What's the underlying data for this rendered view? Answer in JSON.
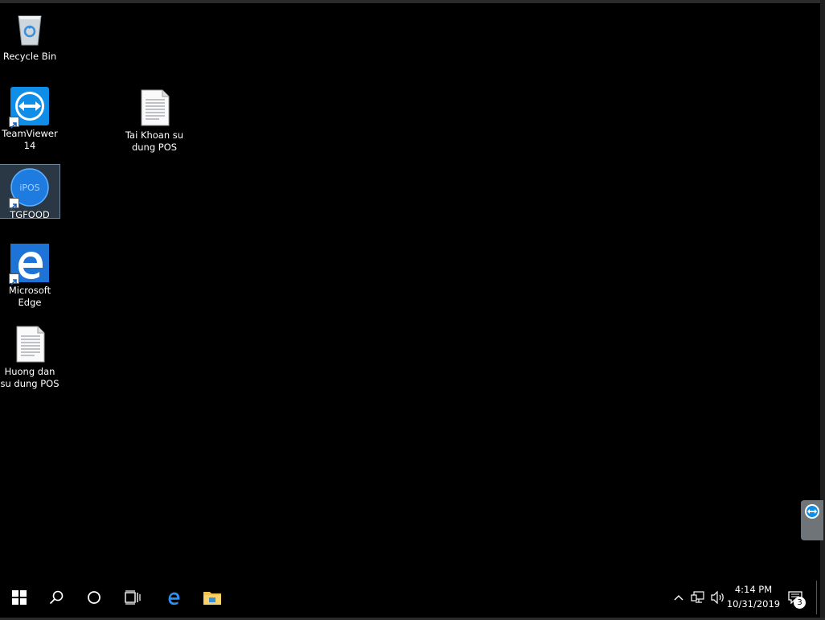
{
  "desktop": {
    "icons": [
      {
        "id": "recycle-bin",
        "label": "Recycle Bin",
        "icon": "recycle-bin-icon"
      },
      {
        "id": "teamviewer",
        "label": "TeamViewer\n14",
        "icon": "teamviewer-icon",
        "shortcut": true
      },
      {
        "id": "tai-khoan",
        "label": "Tai Khoan su\ndung POS",
        "icon": "text-document-icon"
      },
      {
        "id": "tgfood",
        "label": "TGFOOD",
        "icon": "ipos-icon",
        "shortcut": true,
        "selected": true
      },
      {
        "id": "edge",
        "label": "Microsoft\nEdge",
        "icon": "edge-icon",
        "shortcut": true
      },
      {
        "id": "huong-dan",
        "label": "Huong dan\nsu dung POS",
        "icon": "text-document-icon"
      }
    ]
  },
  "taskbar": {
    "buttons": [
      "windows-start-icon",
      "search-icon",
      "cortana-icon",
      "task-view-icon",
      "edge-icon",
      "file-explorer-icon"
    ],
    "tray": [
      "chevron-up-icon",
      "network-icon",
      "volume-icon"
    ],
    "time": "4:14 PM",
    "date": "10/31/2019",
    "notifications_count": "3"
  },
  "colors": {
    "desktop_bg": "#000000",
    "taskbar_bg": "#000000",
    "teamviewer_blue": "#0e8ee9",
    "edge_blue": "#1e73d6",
    "selection": "#6f9ac4"
  }
}
